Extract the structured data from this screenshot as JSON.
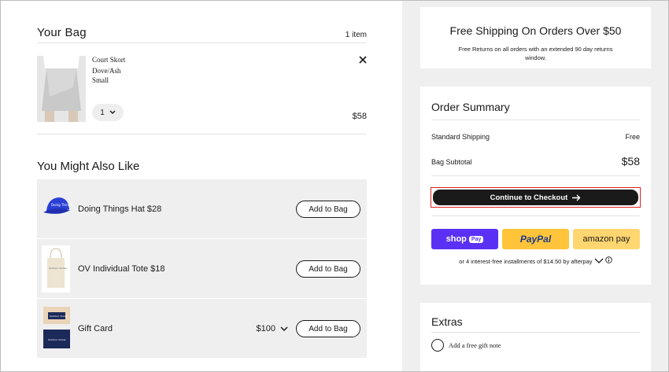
{
  "bag": {
    "title": "Your Bag",
    "count": "1 item",
    "item": {
      "name": "Court Skort",
      "color": "Dove/Ash",
      "size": "Small",
      "quantity": "1",
      "price": "$58"
    }
  },
  "recommendations": {
    "title": "You Might Also Like",
    "items": [
      {
        "label": "Doing Things Hat $28",
        "button": "Add to Bag",
        "hat_text": "Doing Things"
      },
      {
        "label": "OV Individual Tote $18",
        "button": "Add to Bag",
        "tote_text": "Outdoor Voices"
      },
      {
        "label": "Gift Card",
        "amount": "$100",
        "button": "Add to Bag",
        "card_text_1": "Outdoor Voices",
        "card_text_2": "Outdoor Voices"
      }
    ]
  },
  "shipping_banner": {
    "title": "Free Shipping On Orders Over $50",
    "subtitle": "Free Returns on all orders with an extended 90 day returns window."
  },
  "order_summary": {
    "title": "Order Summary",
    "shipping_label": "Standard Shipping",
    "shipping_value": "Free",
    "subtotal_label": "Bag Subtotal",
    "subtotal_value": "$58",
    "checkout_label": "Continue to Checkout",
    "shop_pay_label": "shop",
    "shop_pay_badge": "Pay",
    "paypal_label": "PayPal",
    "amazon_pay_label": "amazon pay",
    "afterpay_text": "or 4 interest-free installments of $14.50 by afterpay"
  },
  "extras": {
    "title": "Extras",
    "gift_note_label": "Add a free gift note"
  },
  "colors": {
    "checkout_bg": "#1a1a1a",
    "highlight": "#e0201c",
    "shop_pay": "#5a31f4",
    "paypal": "#ffc439",
    "amazon_pay": "#ffd670",
    "hat": "#2b3fd6",
    "panel_bg": "#efefef"
  }
}
